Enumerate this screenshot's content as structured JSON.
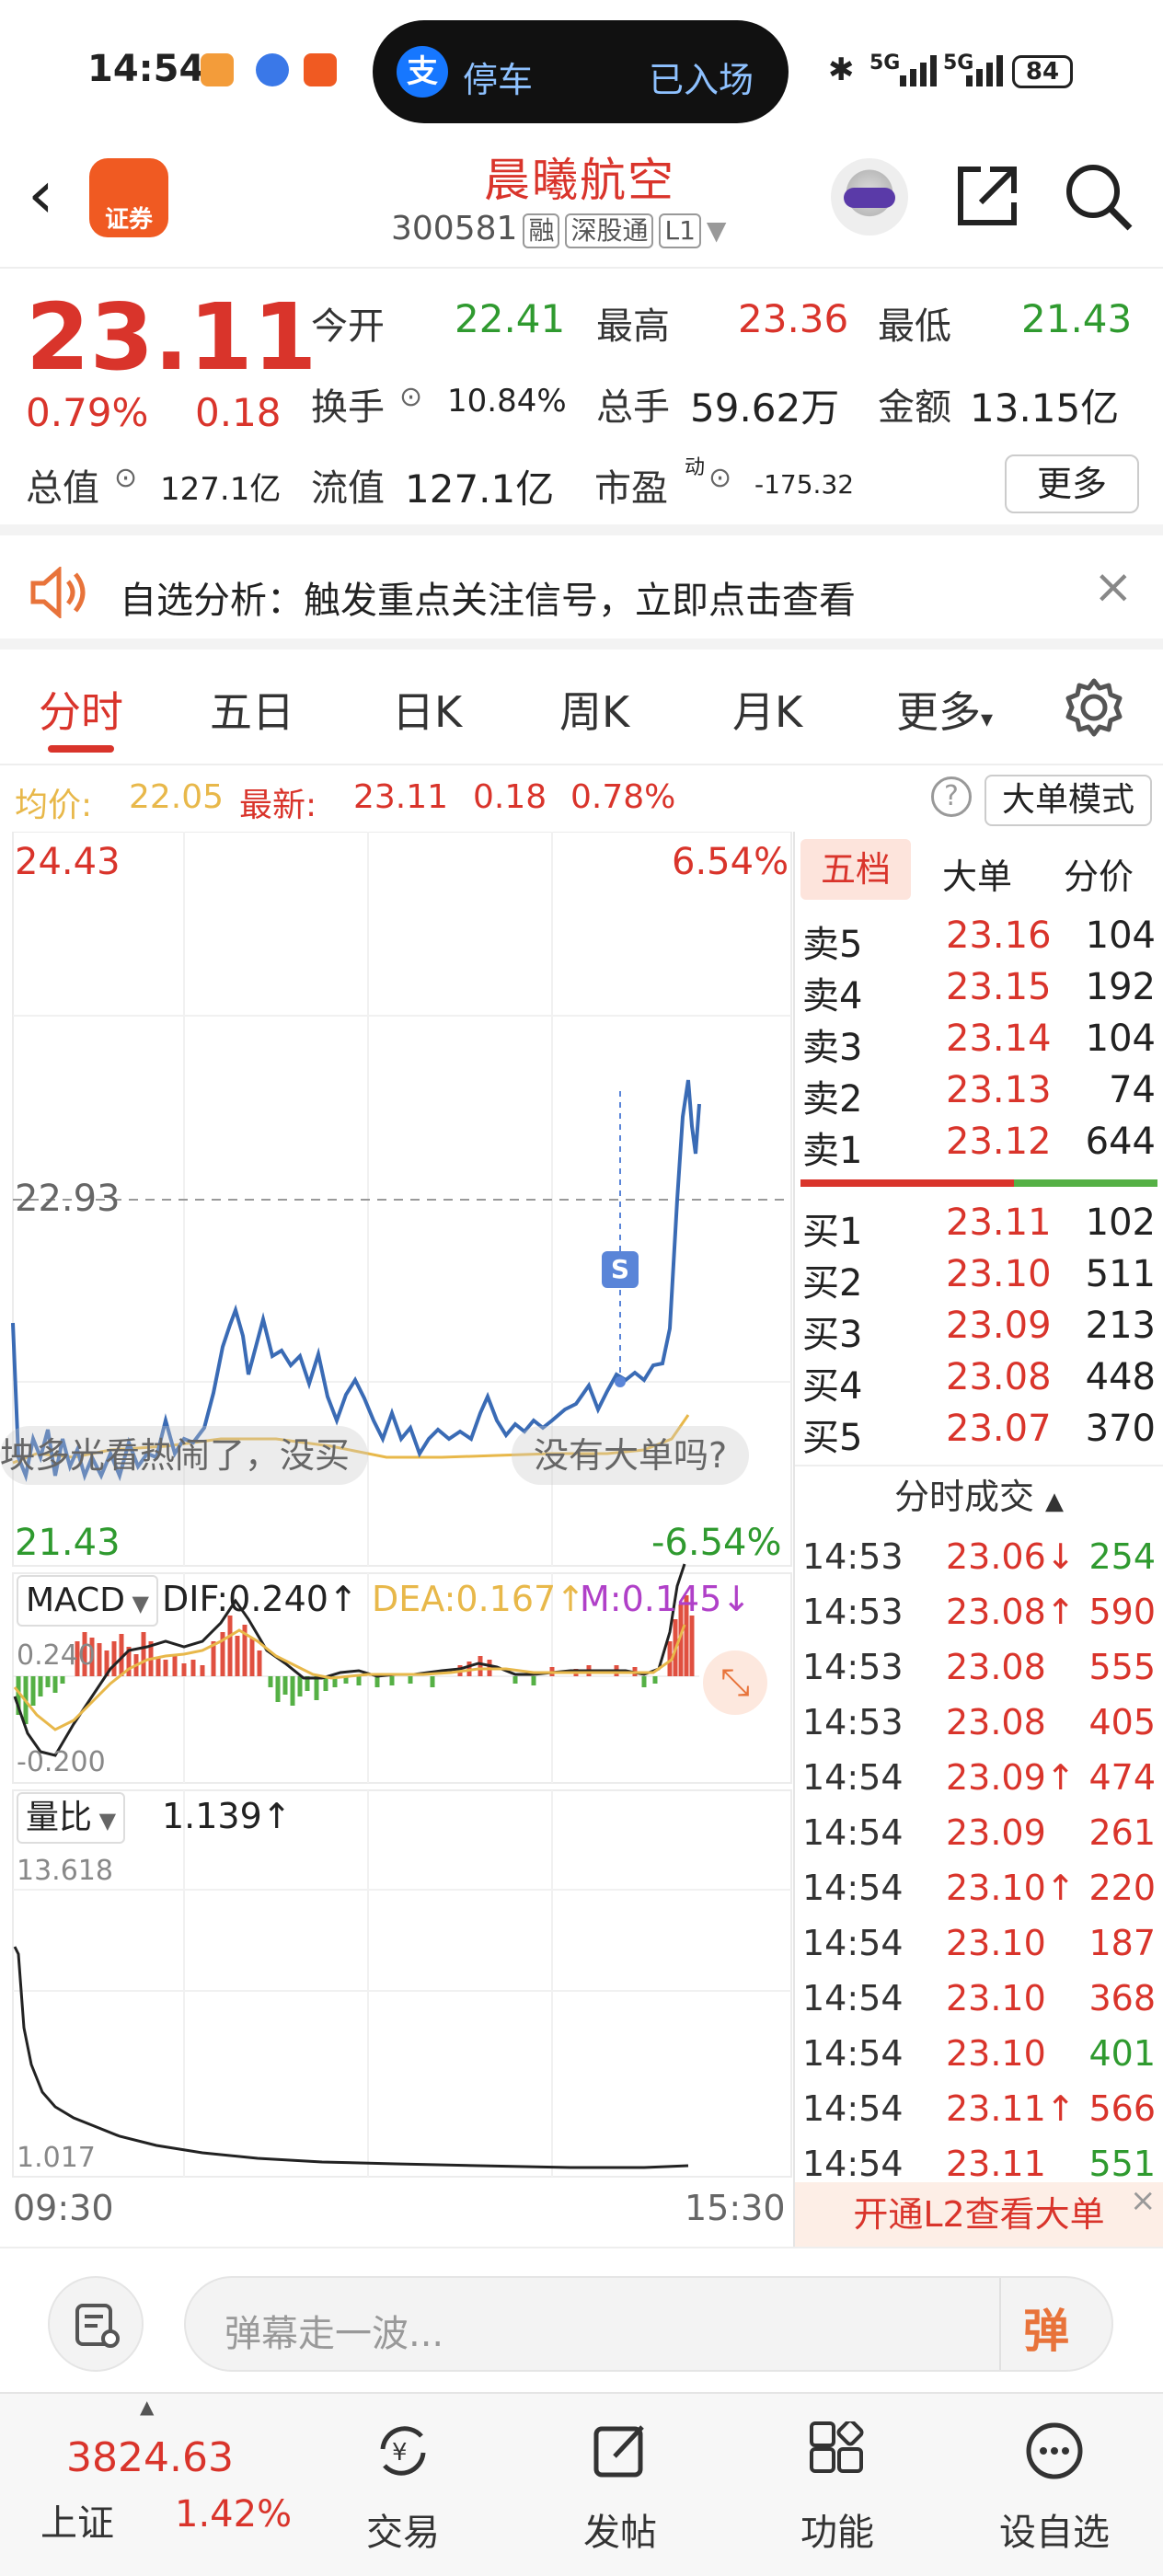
{
  "status_bar": {
    "time": "14:54",
    "pill_left": "停车",
    "pill_right": "已入场",
    "signal1": "5G",
    "signal2": "5G",
    "battery": "84"
  },
  "header": {
    "name": "晨曦航空",
    "code": "300581",
    "tags": [
      "融",
      "深股通",
      "L1"
    ],
    "logo_text": "证券"
  },
  "quote": {
    "price": "23.11",
    "change_pct": "0.79%",
    "change": "0.18",
    "open_label": "今开",
    "open": "22.41",
    "high_label": "最高",
    "high": "23.36",
    "low_label": "最低",
    "low": "21.43",
    "turnover_label": "换手",
    "turnover": "10.84%",
    "volume_label": "总手",
    "volume": "59.62万",
    "amount_label": "金额",
    "amount": "13.15亿",
    "mcap_label": "总值",
    "mcap": "127.1亿",
    "float_label": "流值",
    "float": "127.1亿",
    "pe_label": "市盈",
    "pe_sup": "动",
    "pe": "-175.32",
    "more": "更多"
  },
  "notice": {
    "text": "自选分析：触发重点关注信号，立即点击查看"
  },
  "tabs": [
    "分时",
    "五日",
    "日K",
    "周K",
    "月K",
    "更多"
  ],
  "info_line": {
    "avg_label": "均价:",
    "avg": "22.05",
    "latest_label": "最新:",
    "latest": "23.11",
    "chg": "0.18",
    "pct": "0.78%",
    "mode": "大单模式"
  },
  "chart": {
    "y_top": "24.43",
    "y_top_pct": "6.54%",
    "y_mid": "22.93",
    "y_bottom": "21.43",
    "y_bottom_pct": "-6.54%",
    "marker": "S",
    "bullets": [
      "坱多光看热闹了，没买",
      "没有大单吗?"
    ],
    "macd_label": "MACD",
    "dif": "DIF:0.240↑",
    "dea": "DEA:0.167↑",
    "m": "M:0.145↓",
    "macd_top": "0.240",
    "macd_bottom": "-0.200",
    "ratio_label": "量比",
    "ratio": "1.139↑",
    "ratio_top": "13.618",
    "ratio_bottom": "1.017",
    "x_start": "09:30",
    "x_end": "15:30"
  },
  "book": {
    "tabs": [
      "五档",
      "大单",
      "分价"
    ],
    "asks": [
      {
        "label": "卖5",
        "price": "23.16",
        "vol": "104"
      },
      {
        "label": "卖4",
        "price": "23.15",
        "vol": "192"
      },
      {
        "label": "卖3",
        "price": "23.14",
        "vol": "104"
      },
      {
        "label": "卖2",
        "price": "23.13",
        "vol": "74"
      },
      {
        "label": "卖1",
        "price": "23.12",
        "vol": "644"
      }
    ],
    "bids": [
      {
        "label": "买1",
        "price": "23.11",
        "vol": "102"
      },
      {
        "label": "买2",
        "price": "23.10",
        "vol": "511"
      },
      {
        "label": "买3",
        "price": "23.09",
        "vol": "213"
      },
      {
        "label": "买4",
        "price": "23.08",
        "vol": "448"
      },
      {
        "label": "买5",
        "price": "23.07",
        "vol": "370"
      }
    ],
    "trades_header": "分时成交",
    "trades": [
      {
        "time": "14:53",
        "price": "23.06↓",
        "vol": "254",
        "side": "buy"
      },
      {
        "time": "14:53",
        "price": "23.08↑",
        "vol": "590",
        "side": "sell"
      },
      {
        "time": "14:53",
        "price": "23.08",
        "vol": "555",
        "side": "sell"
      },
      {
        "time": "14:53",
        "price": "23.08",
        "vol": "405",
        "side": "sell"
      },
      {
        "time": "14:54",
        "price": "23.09↑",
        "vol": "474",
        "side": "sell"
      },
      {
        "time": "14:54",
        "price": "23.09",
        "vol": "261",
        "side": "sell"
      },
      {
        "time": "14:54",
        "price": "23.10↑",
        "vol": "220",
        "side": "sell"
      },
      {
        "time": "14:54",
        "price": "23.10",
        "vol": "187",
        "side": "sell"
      },
      {
        "time": "14:54",
        "price": "23.10",
        "vol": "368",
        "side": "sell"
      },
      {
        "time": "14:54",
        "price": "23.10",
        "vol": "401",
        "side": "buy"
      },
      {
        "time": "14:54",
        "price": "23.11↑",
        "vol": "566",
        "side": "sell"
      },
      {
        "time": "14:54",
        "price": "23.11",
        "vol": "551",
        "side": "buy"
      }
    ],
    "l2_banner": "开通L2查看大单"
  },
  "danmu": {
    "placeholder": "弹幕走一波...",
    "send": "弹"
  },
  "tabbar": {
    "index_value": "3824.63",
    "index_name": "上证",
    "index_pct": "1.42%",
    "items": [
      "交易",
      "发帖",
      "功能",
      "设自选"
    ]
  },
  "colors": {
    "up": "#d9342b",
    "down": "#2f9a2f",
    "avg_line": "#e8b84a",
    "price_line": "#3a6bb5"
  }
}
